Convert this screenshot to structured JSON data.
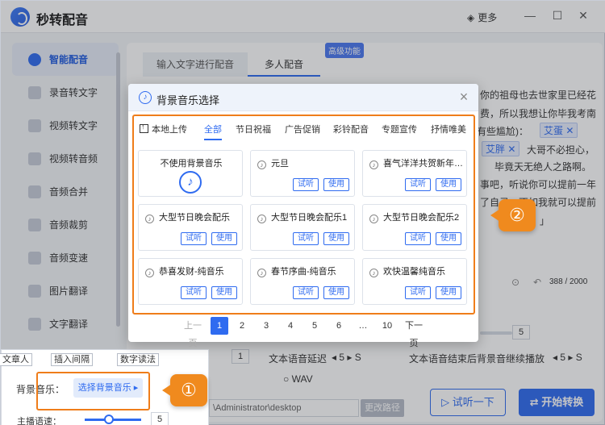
{
  "app": {
    "title": "秒转配音",
    "more_label": "更多"
  },
  "sidebar": {
    "items": [
      {
        "label": "智能配音",
        "active": true
      },
      {
        "label": "录音转文字"
      },
      {
        "label": "视频转文字"
      },
      {
        "label": "视频转音频"
      },
      {
        "label": "音频合并"
      },
      {
        "label": "音频裁剪"
      },
      {
        "label": "音频变速"
      },
      {
        "label": "图片翻译"
      },
      {
        "label": "文字翻译"
      }
    ]
  },
  "main": {
    "tab_input": "输入文字进行配音",
    "tab_multi": "多人配音",
    "pro_badge": "高级功能",
    "text_lines": [
      "你的祖母也去世家里已经花",
      "费，所以我想让你毕我考南",
      "有些尴尬)：",
      "大哥不必担心，",
      "毕竟天无绝人之路啊。",
      "事吧，听说你可以提前一年",
      "了自己，不如我就可以提前",
      "的名字？」"
    ],
    "chip_egg": "艾蛋",
    "chip_fat": "艾胖",
    "char_count": "388 / 2000",
    "slider_value_right": "5",
    "slider_value_mid": "1",
    "slider_value_left": "5",
    "delay_label": "文本语音延迟",
    "delay_value": "5",
    "delay_unit": "S",
    "continue_label": "文本语音结束后背景音继续播放",
    "continue_value": "5",
    "continue_unit": "S",
    "wav_label": "WAV",
    "path_value": "\\Administrator\\desktop",
    "path_button": "更改路径",
    "try_button": "试听一下",
    "convert_button": "开始转换"
  },
  "bottom_left": {
    "top_items": [
      "文章人",
      "插入间隔",
      "数字读法"
    ],
    "bgm_label": "背景音乐：",
    "bgm_button": "选择背景音乐",
    "speed_label": "主播语速：",
    "speed_value": "5",
    "speed_level": 0.5
  },
  "modal": {
    "title": "背景音乐选择",
    "upload_label": "本地上传",
    "tabs": [
      "全部",
      "节日祝福",
      "广告促销",
      "彩铃配音",
      "专题宣传",
      "抒情唯美"
    ],
    "active_tab": "全部",
    "none_label": "不使用背景音乐",
    "listen_label": "试听",
    "use_label": "使用",
    "tracks": [
      "元旦",
      "喜气洋洋共贺新年…",
      "大型节日晚会配乐",
      "大型节日晚会配乐1",
      "大型节日晚会配乐2",
      "恭喜发财-纯音乐",
      "春节序曲-纯音乐",
      "欢快温馨纯音乐"
    ],
    "pager": {
      "prev": "上一页",
      "next": "下一页",
      "pages": [
        "1",
        "2",
        "3",
        "4",
        "5",
        "6",
        "…",
        "10"
      ],
      "current": "1"
    }
  },
  "markers": {
    "one": "①",
    "two": "②"
  },
  "colors": {
    "accent": "#2f6bf0",
    "highlight": "#ef7d1a"
  }
}
